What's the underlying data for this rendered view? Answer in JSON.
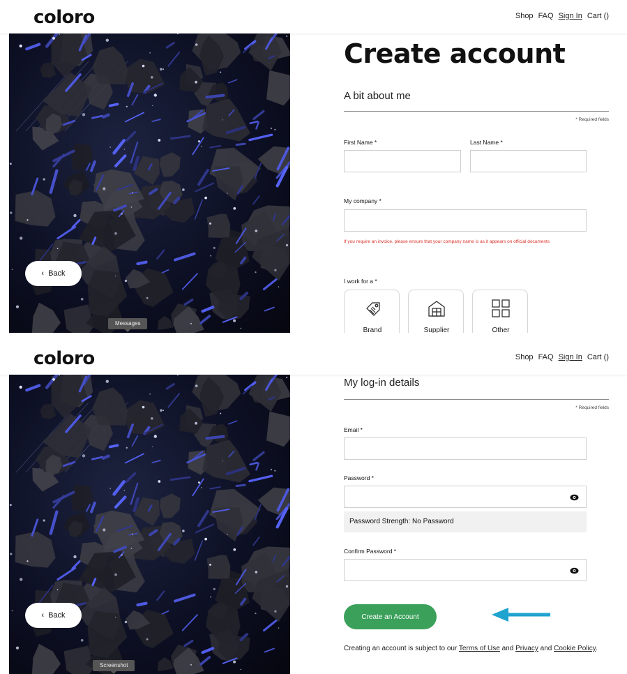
{
  "brand": {
    "logo_text": "coloro"
  },
  "nav": {
    "shop": "Shop",
    "faq": "FAQ",
    "sign_in": "Sign In",
    "cart": "Cart ()"
  },
  "back_label": "Back",
  "panel1": {
    "heading": "Create account",
    "section_title": "A bit about me",
    "required_note": "* Required fields",
    "first_name_label": "First Name *",
    "last_name_label": "Last Name *",
    "company_label": "My company *",
    "company_hint": "If you require an invoice, please ensure that your company name is as it appears on official documents",
    "work_for_label": "I work for a *",
    "work_options": [
      {
        "label": "Brand",
        "icon": "tag-icon"
      },
      {
        "label": "Supplier",
        "icon": "warehouse-icon"
      },
      {
        "label": "Other",
        "icon": "grid-icon"
      }
    ],
    "tooltip": "Messages"
  },
  "panel2": {
    "section_title": "My log-in details",
    "required_note": "* Required fields",
    "email_label": "Email *",
    "password_label": "Password *",
    "password_strength": "Password Strength: No Password",
    "confirm_label": "Confirm Password *",
    "create_button": "Create an Account",
    "terms_prefix": "Creating an account is subject to our ",
    "terms_link": "Terms of Use",
    "terms_and": " and ",
    "privacy_link": "Privacy",
    "cookie_link": "Cookie Policy",
    "tooltip": "Screenshot"
  },
  "colors": {
    "accent_green": "#3aa05a",
    "annotation_arrow": "#1fa3cf",
    "hint_red": "#d9342b"
  }
}
